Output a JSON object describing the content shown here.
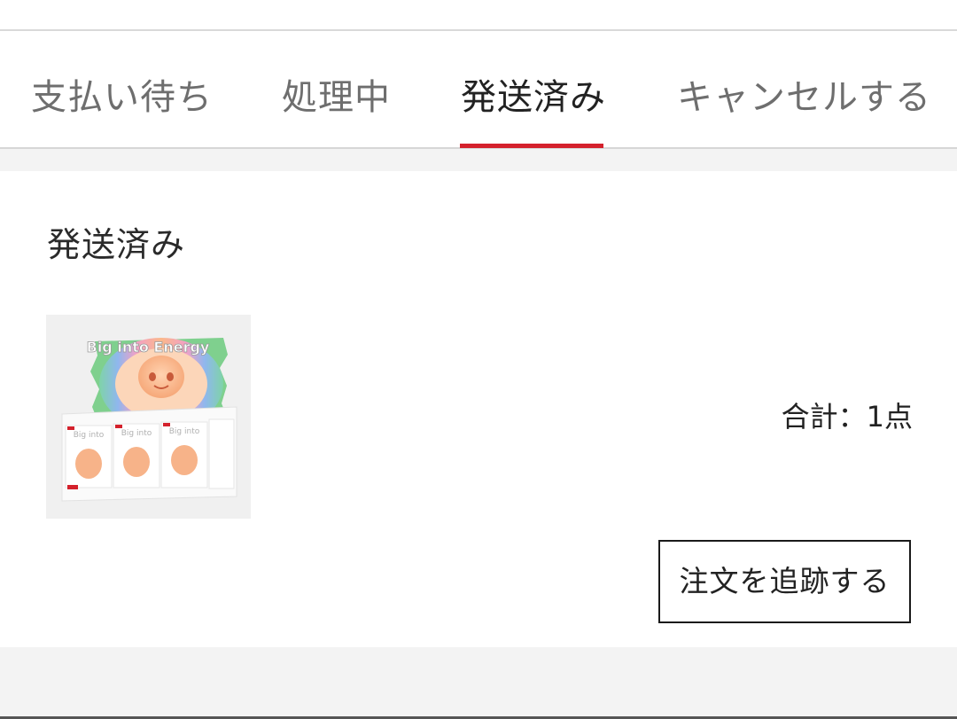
{
  "tabs": [
    {
      "label": "支払い待ち",
      "active": false
    },
    {
      "label": "処理中",
      "active": false
    },
    {
      "label": "発送済み",
      "active": true
    },
    {
      "label": "キャンセルする",
      "active": false
    }
  ],
  "colors": {
    "accent": "#d4212c",
    "text_primary": "#222222",
    "text_secondary": "#6e6e6e",
    "page_background": "#f3f3f3"
  },
  "order": {
    "status_title": "発送済み",
    "product_image": {
      "icon": "product-box-image",
      "brand_text": "Big into Energy"
    },
    "total_label": "合計：1点",
    "track_button_label": "注文を追跡する"
  }
}
